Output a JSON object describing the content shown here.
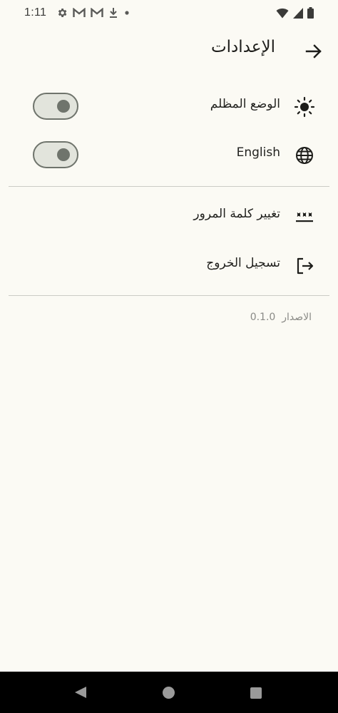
{
  "status_bar": {
    "time": "1:11",
    "left_icons": [
      "settings-icon",
      "gmail-icon",
      "gmail-icon",
      "download-icon",
      "dot-icon"
    ],
    "right_icons": [
      "wifi-icon",
      "signal-icon",
      "battery-icon"
    ]
  },
  "app_bar": {
    "title": "الإعدادات",
    "back_icon": "arrow-right-icon"
  },
  "settings": {
    "dark_mode": {
      "label": "الوضع المظلم",
      "icon": "sun-icon",
      "enabled": false
    },
    "language": {
      "label": "English",
      "icon": "globe-icon",
      "enabled": false
    },
    "change_password": {
      "label": "تغيير كلمة المرور",
      "icon": "password-icon"
    },
    "logout": {
      "label": "تسجيل الخروج",
      "icon": "logout-icon"
    }
  },
  "version": {
    "label": "الاصدار",
    "number": "0.1.0"
  },
  "colors": {
    "background": "#fbfaf4",
    "switch_track": "#e2e4dc",
    "switch_outline": "#6f746c",
    "divider": "#cbcbc5",
    "nav_bar": "#000000"
  }
}
